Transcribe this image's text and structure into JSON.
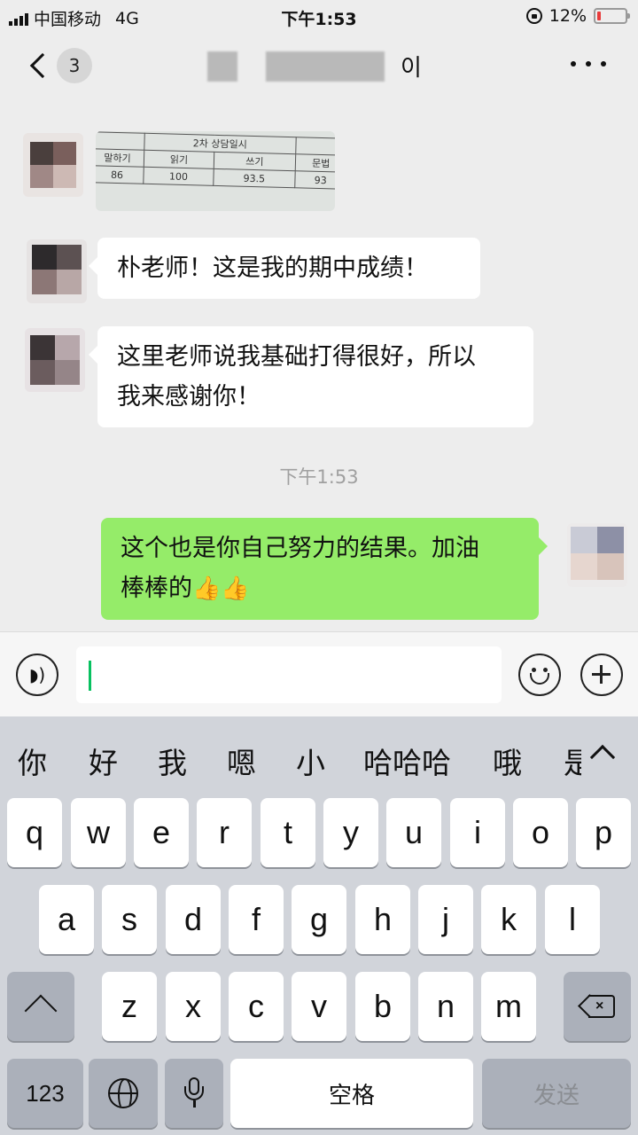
{
  "status_bar": {
    "carrier": "中国移动",
    "network": "4G",
    "time": "下午1:53",
    "battery_percent": "12%",
    "battery_level": 0.12,
    "battery_color": "#e83b3b"
  },
  "nav": {
    "unread_count": "3",
    "title_visible_fragment": "이"
  },
  "messages": [
    {
      "side": "left",
      "type": "image",
      "table": {
        "title": "2차 상담일시",
        "headers": [
          "말하기",
          "읽기",
          "쓰기",
          "문법"
        ],
        "values": [
          "86",
          "100",
          "93.5",
          "93"
        ]
      }
    },
    {
      "side": "left",
      "type": "text",
      "text": "朴老师！这是我的期中成绩！"
    },
    {
      "side": "left",
      "type": "text",
      "text_lines": [
        "这里老师说我基础打得很好，所以",
        "我来感谢你！"
      ]
    },
    {
      "side": "right",
      "type": "text",
      "text_lines": [
        "这个也是你自己努力的结果。加油",
        "棒棒的"
      ],
      "emoji": "👍👍"
    }
  ],
  "timestamp": "下午1:53",
  "input": {
    "value": ""
  },
  "keyboard": {
    "candidates": [
      "你",
      "好",
      "我",
      "嗯",
      "小",
      "哈哈哈",
      "哦",
      "是"
    ],
    "row1": [
      "q",
      "w",
      "e",
      "r",
      "t",
      "y",
      "u",
      "i",
      "o",
      "p"
    ],
    "row2": [
      "a",
      "s",
      "d",
      "f",
      "g",
      "h",
      "j",
      "k",
      "l"
    ],
    "row3": [
      "z",
      "x",
      "c",
      "v",
      "b",
      "n",
      "m"
    ],
    "numbers_label": "123",
    "space_label": "空格",
    "send_label": "发送"
  },
  "colors": {
    "chat_background": "#ededed",
    "sent_bubble": "#95ec69",
    "received_bubble": "#ffffff",
    "caret": "#07c160",
    "keyboard_background": "#d1d4da"
  }
}
